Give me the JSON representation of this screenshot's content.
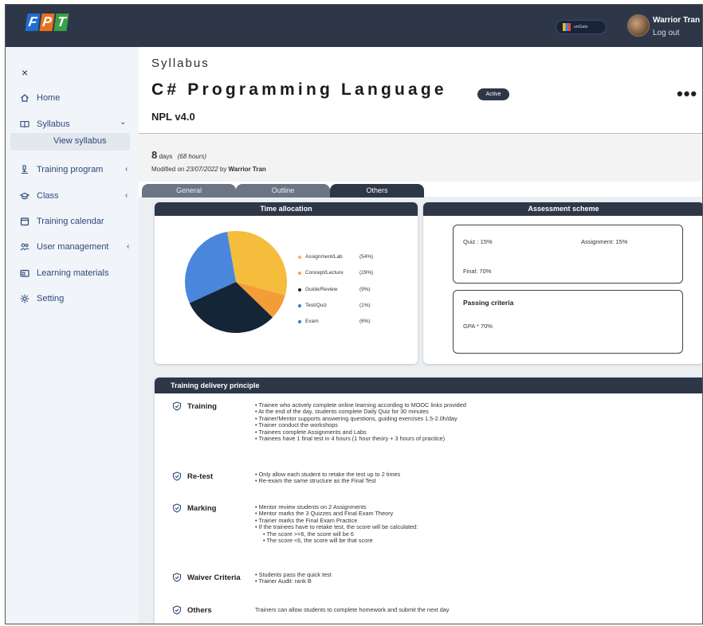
{
  "header": {
    "logo": [
      "F",
      "P",
      "T"
    ],
    "unigate_label": "uniGate",
    "user_name": "Warrior Tran",
    "logout_label": "Log out"
  },
  "sidebar": {
    "close_icon": "×",
    "items": [
      {
        "label": "Home",
        "icon": "home-icon"
      },
      {
        "label": "Syllabus",
        "icon": "book-icon",
        "chevron": "⌄"
      },
      {
        "label": "Training program",
        "icon": "microscope-icon",
        "chevron": "‹"
      },
      {
        "label": "Class",
        "icon": "graduation-cap-icon",
        "chevron": "‹"
      },
      {
        "label": "Training calendar",
        "icon": "calendar-icon"
      },
      {
        "label": "User management",
        "icon": "users-icon",
        "chevron": "‹"
      },
      {
        "label": "Learning materials",
        "icon": "folder-icon"
      },
      {
        "label": "Setting",
        "icon": "gear-icon"
      }
    ],
    "sub_item": "View syllabus"
  },
  "page": {
    "label": "Syllabus",
    "title": "C# Programming Language",
    "status": "Active",
    "more": "•••",
    "version": "NPL v4.0",
    "days_num": "8",
    "days_text": " days",
    "hours_text": "(68 hours)",
    "modified_prefix": "Modified on ",
    "modified_date": "23/07/2022",
    "modified_by_prefix": " by ",
    "modified_by": "Warrior Tran"
  },
  "tabs": [
    "General",
    "Outline",
    "Others"
  ],
  "time_allocation": {
    "title": "Time allocation",
    "legend": [
      {
        "label": "Assignment/Lab",
        "pct": "(54%)",
        "color": "#f4b942"
      },
      {
        "label": "Concept/Lecture",
        "pct": "(29%)",
        "color": "#f4a742"
      },
      {
        "label": "Guide/Review",
        "pct": "(9%)",
        "color": "#152538"
      },
      {
        "label": "Test/Quiz",
        "pct": "(1%)",
        "color": "#3a76d8"
      },
      {
        "label": "Exam",
        "pct": "(6%)",
        "color": "#3a76d8"
      }
    ]
  },
  "chart_data": {
    "type": "pie",
    "slices": [
      {
        "label": "Assignment/Lab",
        "value": 32,
        "color": "#f4bd3c"
      },
      {
        "label": "Concept/Lecture",
        "value": 8,
        "color": "#f39d38"
      },
      {
        "label": "Guide/Review",
        "value": 31,
        "color": "#152538"
      },
      {
        "label": "Test/Quiz + Exam",
        "value": 29,
        "color": "#4a86dc"
      }
    ]
  },
  "assessment": {
    "title": "Assessment scheme",
    "quiz": "Quiz :  15%",
    "assignment": "Assignment:  15%",
    "final": "Final:  70%",
    "passing_title": "Passing criteria",
    "gpa": "GPA *  70%"
  },
  "delivery": {
    "title": "Training delivery principle",
    "sections": [
      {
        "label": "Training",
        "bullets": [
          "• Trainee who actively complete online learning according to MOOC links provided",
          "• At the end of the day, students complete Daily Quiz for 30 minutes",
          "• Trainer/Mentor supports answering questions, guiding exercises 1.5-2.0h/day",
          "• Trainer conduct the workshops",
          "• Trainees complete Assignments and Labs",
          "• Trainees have 1 final test in 4 hours (1 hour theory + 3 hours of practice)"
        ]
      },
      {
        "label": "Re-test",
        "bullets": [
          "• Only allow each student to retake the test up to 2 times",
          "• Re-exam the same structure as the Final Test"
        ]
      },
      {
        "label": "Marking",
        "bullets": [
          "• Mentor review students on 2 Assignments",
          "• Mentor marks the 3 Quizzes and Final Exam Theory",
          "• Trainer marks the Final Exam Practice",
          "• If the trainees have to retake test, the score will be calculated:",
          "     • The score >=6, the score will be 6",
          "     • The score <6, the score will be that score"
        ]
      },
      {
        "label": "Waiver Criteria",
        "bullets": [
          "• Students pass the quick test",
          "• Trainer Audit: rank B"
        ]
      },
      {
        "label": "Others",
        "bullets": [
          "Trainers can allow students to complete homework and submit the next day"
        ]
      }
    ]
  }
}
